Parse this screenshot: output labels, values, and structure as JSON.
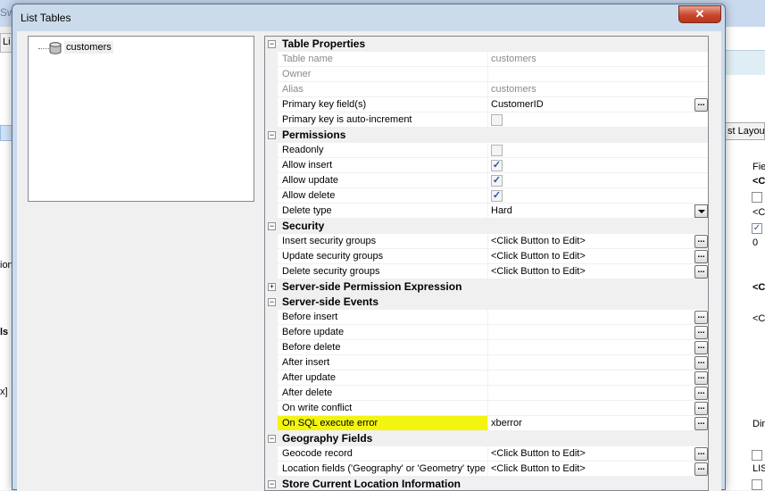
{
  "background": {
    "title_fragment": "Swe",
    "tab_fragment": "Li",
    "left_fragments": [
      "ions",
      "ls",
      "x]"
    ],
    "right_tab": "st Layout",
    "right_cells": [
      "Fie",
      "<C",
      "<Cl",
      "0",
      "<C",
      "<Cl",
      "Dirt",
      "LIS"
    ]
  },
  "dialog": {
    "title": "List Tables",
    "close_symbol": "✕"
  },
  "tree": {
    "items": [
      {
        "label": "customers",
        "icon": "database-table-icon"
      }
    ]
  },
  "grid": {
    "categories": [
      {
        "label": "Table Properties",
        "expanded": true,
        "rows": [
          {
            "name": "Table name",
            "value": "customers",
            "disabled": true
          },
          {
            "name": "Owner",
            "value": "",
            "disabled": true
          },
          {
            "name": "Alias",
            "value": "customers",
            "disabled": true
          },
          {
            "name": "Primary key field(s)",
            "value": "CustomerID",
            "button": "..."
          },
          {
            "name": "Primary key is auto-increment",
            "checkbox": false,
            "checkbox_disabled": true
          }
        ]
      },
      {
        "label": "Permissions",
        "expanded": true,
        "rows": [
          {
            "name": "Readonly",
            "checkbox": false,
            "checkbox_disabled": true
          },
          {
            "name": "Allow insert",
            "checkbox": true,
            "checkbox_disabled": true
          },
          {
            "name": "Allow update",
            "checkbox": true,
            "checkbox_disabled": true
          },
          {
            "name": "Allow delete",
            "checkbox": true,
            "checkbox_disabled": true
          },
          {
            "name": "Delete type",
            "value": "Hard",
            "dropdown": true
          }
        ]
      },
      {
        "label": "Security",
        "expanded": true,
        "rows": [
          {
            "name": "Insert security groups",
            "value": "<Click Button to Edit>",
            "button": "..."
          },
          {
            "name": "Update security groups",
            "value": "<Click Button to Edit>",
            "button": "..."
          },
          {
            "name": "Delete security groups",
            "value": "<Click Button to Edit>",
            "button": "..."
          }
        ]
      },
      {
        "label": "Server-side Permission Expression",
        "expanded": false,
        "rows": []
      },
      {
        "label": "Server-side Events",
        "expanded": true,
        "rows": [
          {
            "name": "Before insert",
            "value": "",
            "button": "..."
          },
          {
            "name": "Before update",
            "value": "",
            "button": "..."
          },
          {
            "name": "Before delete",
            "value": "",
            "button": "..."
          },
          {
            "name": "After insert",
            "value": "",
            "button": "..."
          },
          {
            "name": "After update",
            "value": "",
            "button": "..."
          },
          {
            "name": "After delete",
            "value": "",
            "button": "..."
          },
          {
            "name": "On write conflict",
            "value": "",
            "button": "..."
          },
          {
            "name": "On SQL execute error",
            "value": "xberror",
            "button": "...",
            "highlight": true
          }
        ]
      },
      {
        "label": "Geography Fields",
        "expanded": true,
        "rows": [
          {
            "name": "Geocode record",
            "value": "<Click Button to Edit>",
            "button": "..."
          },
          {
            "name": "Location fields ('Geography' or 'Geometry' type fiel",
            "value": "<Click Button to Edit>",
            "button": "..."
          }
        ]
      },
      {
        "label": "Store Current Location Information",
        "expanded": true,
        "rows": []
      }
    ]
  },
  "colors": {
    "highlight": "#f3f511",
    "titlebar": "#cbdbec",
    "close_button": "#c9472d"
  }
}
